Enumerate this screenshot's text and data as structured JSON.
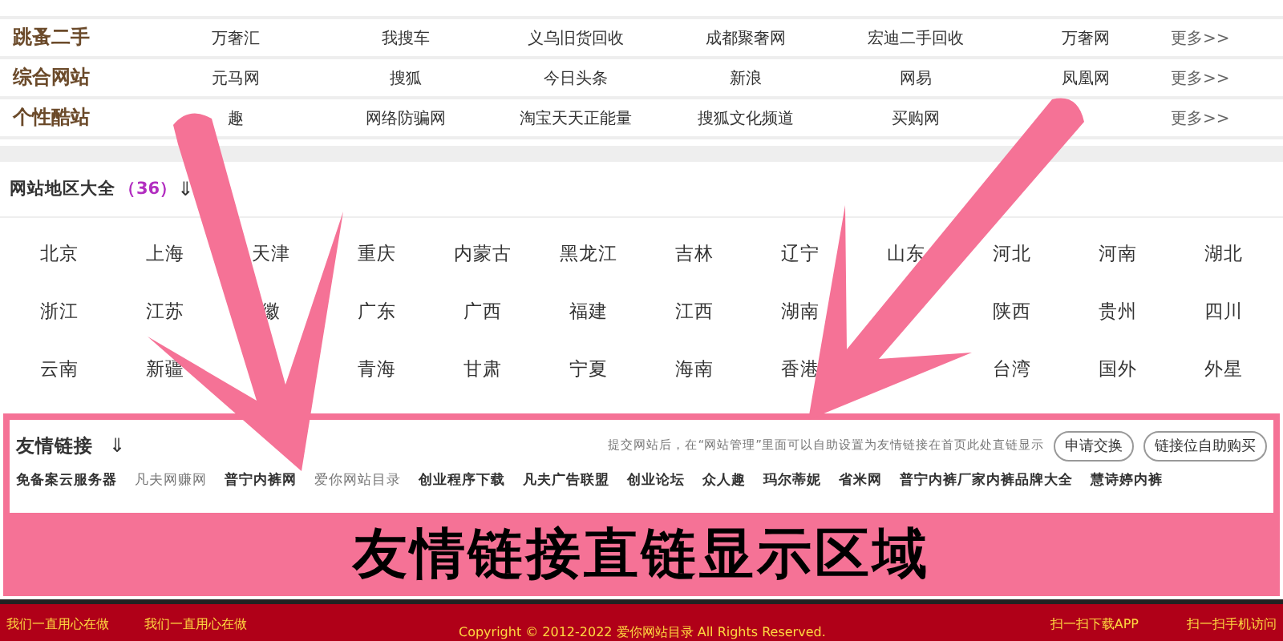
{
  "categories": [
    {
      "name": "跳蚤二手",
      "links": [
        "万奢汇",
        "我搜车",
        "义乌旧货回收",
        "成都聚奢网",
        "宏迪二手回收",
        "万奢网"
      ],
      "more": "更多>>"
    },
    {
      "name": "综合网站",
      "links": [
        "元马网",
        "搜狐",
        "今日头条",
        "新浪",
        "网易",
        "凤凰网"
      ],
      "more": "更多>>"
    },
    {
      "name": "个性酷站",
      "links": [
        "趣",
        "网络防骗网",
        "淘宝天天正能量",
        "搜狐文化频道",
        "买购网"
      ],
      "more": "更多>>"
    }
  ],
  "regions": {
    "title": "网站地区大全",
    "count": "（36）",
    "toggle": "⇓",
    "items": [
      {
        "kind": "link",
        "text": "北京"
      },
      {
        "kind": "link",
        "text": "上海"
      },
      {
        "kind": "link",
        "text": "天津"
      },
      {
        "kind": "link",
        "text": "重庆"
      },
      {
        "kind": "link",
        "text": "内蒙古"
      },
      {
        "kind": "link",
        "text": "黑龙江"
      },
      {
        "kind": "link",
        "text": "吉林"
      },
      {
        "kind": "link",
        "text": "辽宁"
      },
      {
        "kind": "link",
        "text": "山东"
      },
      {
        "kind": "link",
        "text": "河北"
      },
      {
        "kind": "link",
        "text": "河南"
      },
      {
        "kind": "link",
        "text": "湖北"
      },
      {
        "kind": "link",
        "text": "浙江"
      },
      {
        "kind": "link",
        "text": "江苏"
      },
      {
        "kind": "link",
        "text": "徽"
      },
      {
        "kind": "link",
        "text": "广东"
      },
      {
        "kind": "link",
        "text": "广西"
      },
      {
        "kind": "link",
        "text": "福建"
      },
      {
        "kind": "link",
        "text": "江西"
      },
      {
        "kind": "link",
        "text": "湖南"
      },
      {
        "kind": "covered"
      },
      {
        "kind": "link",
        "text": "陕西"
      },
      {
        "kind": "link",
        "text": "贵州"
      },
      {
        "kind": "link",
        "text": "四川"
      },
      {
        "kind": "link",
        "text": "云南"
      },
      {
        "kind": "link",
        "text": "新疆"
      },
      {
        "kind": "covered"
      },
      {
        "kind": "link",
        "text": "青海"
      },
      {
        "kind": "link",
        "text": "甘肃"
      },
      {
        "kind": "link",
        "text": "宁夏"
      },
      {
        "kind": "link",
        "text": "海南"
      },
      {
        "kind": "link",
        "text": "香港"
      },
      {
        "kind": "covered"
      },
      {
        "kind": "link",
        "text": "台湾"
      },
      {
        "kind": "link",
        "text": "国外"
      },
      {
        "kind": "link",
        "text": "外星"
      }
    ]
  },
  "friend_links": {
    "title": "友情链接",
    "toggle": "⇓",
    "notice": "提交网站后，在“网站管理”里面可以自助设置为友情链接在首页此处直链显示",
    "buttons": [
      "申请交换",
      "链接位自助购买"
    ],
    "links": [
      {
        "text": "免备案云服务器",
        "muted": false
      },
      {
        "text": "凡夫网赚网",
        "muted": true
      },
      {
        "text": "普宁内裤网",
        "muted": false
      },
      {
        "text": "爱你网站目录",
        "muted": true
      },
      {
        "text": "创业程序下载",
        "muted": false
      },
      {
        "text": "凡夫广告联盟",
        "muted": false
      },
      {
        "text": "创业论坛",
        "muted": false
      },
      {
        "text": "众人趣",
        "muted": false
      },
      {
        "text": "玛尔蒂妮",
        "muted": false
      },
      {
        "text": "省米网",
        "muted": false
      },
      {
        "text": "普宁内裤厂家内裤品牌大全",
        "muted": false
      },
      {
        "text": "慧诗婷内裤",
        "muted": false
      }
    ]
  },
  "caption": "友情链接直链显示区域",
  "footer": {
    "left": [
      "我们一直用心在做",
      "我们一直用心在做"
    ],
    "copyright": "Copyright © 2012-2022  爱你网站目录  All Rights Reserved.",
    "right": [
      "扫一扫下载APP",
      "扫一扫手机访问"
    ]
  }
}
